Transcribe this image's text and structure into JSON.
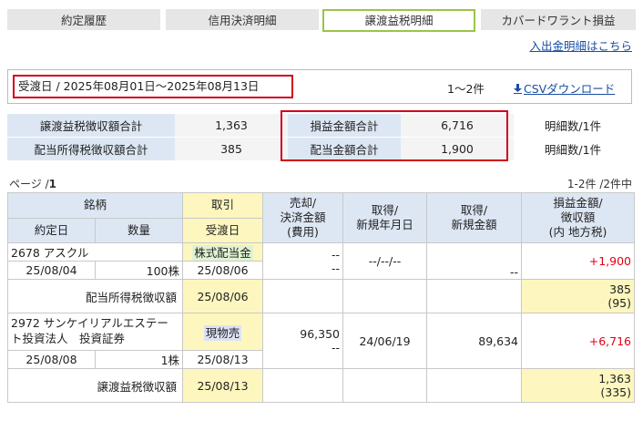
{
  "tabs": [
    {
      "label": "約定履歴"
    },
    {
      "label": "信用決済明細"
    },
    {
      "label": "譲渡益税明細"
    },
    {
      "label": "カバードワラント損益"
    }
  ],
  "links": {
    "deposit_history": "入出金明細はこちら",
    "csv_download": "CSVダウンロード"
  },
  "period": {
    "text": "受渡日 / 2025年08月01日～2025年08月13日",
    "count": "1～2件"
  },
  "summary": {
    "rows": [
      {
        "label1": "譲渡益税徴収額合計",
        "value1": "1,363",
        "label2": "損益金額合計",
        "value2": "6,716",
        "detail": "明細数/1件"
      },
      {
        "label1": "配当所得税徴収額合計",
        "value1": "385",
        "label2": "配当金額合計",
        "value2": "1,900",
        "detail": "明細数/1件"
      }
    ]
  },
  "pagination": {
    "page_label": "ページ /",
    "page_number": "1",
    "range": "1-2件 /2件中"
  },
  "table": {
    "headers": {
      "meigara": "銘柄",
      "torihiki": "取引",
      "baikyaku": [
        "売却/",
        "決済金額",
        "(費用)"
      ],
      "shutoku_date": [
        "取得/",
        "新規年月日"
      ],
      "shutoku_amount": [
        "取得/",
        "新規金額"
      ],
      "profit": [
        "損益金額/",
        "徴収額",
        "(内 地方税)"
      ],
      "yakujo_date": "約定日",
      "quantity": "数量",
      "ukewatashi": "受渡日"
    },
    "rows": [
      {
        "name": "2678 アスクル",
        "trade_type": "株式配当金",
        "sale_amount": "--",
        "sale_cost": "--",
        "acq_date": "--/--/--",
        "acq_amount": "--",
        "profit": "+1,900",
        "trade_date": "25/08/04",
        "qty": "100株",
        "settle_date": "25/08/06"
      },
      {
        "tax_label": "配当所得税徴収額",
        "tax_date": "25/08/06",
        "tax_amount": "385",
        "tax_local": "(95)"
      },
      {
        "name_line1": "2972 サンケイリアルエステー",
        "name_line2": "ト投資法人　投資証券",
        "trade_type": "現物売",
        "sale_amount": "96,350",
        "sale_cost": "--",
        "acq_date": "24/06/19",
        "acq_amount": "89,634",
        "profit": "+6,716",
        "trade_date": "25/08/08",
        "qty": "1株",
        "settle_date": "25/08/13"
      },
      {
        "tax_label": "譲渡益税徴収額",
        "tax_date": "25/08/13",
        "tax_amount": "1,363",
        "tax_local": "(335)"
      }
    ]
  },
  "colors": {
    "accent_border": "#9bc34a",
    "highlight_red": "#d0021b",
    "header_blue": "#dde7f4",
    "yellow": "#fdf7bf",
    "profit_red": "#e20015"
  },
  "icons": {
    "download": "download-arrow-icon"
  }
}
